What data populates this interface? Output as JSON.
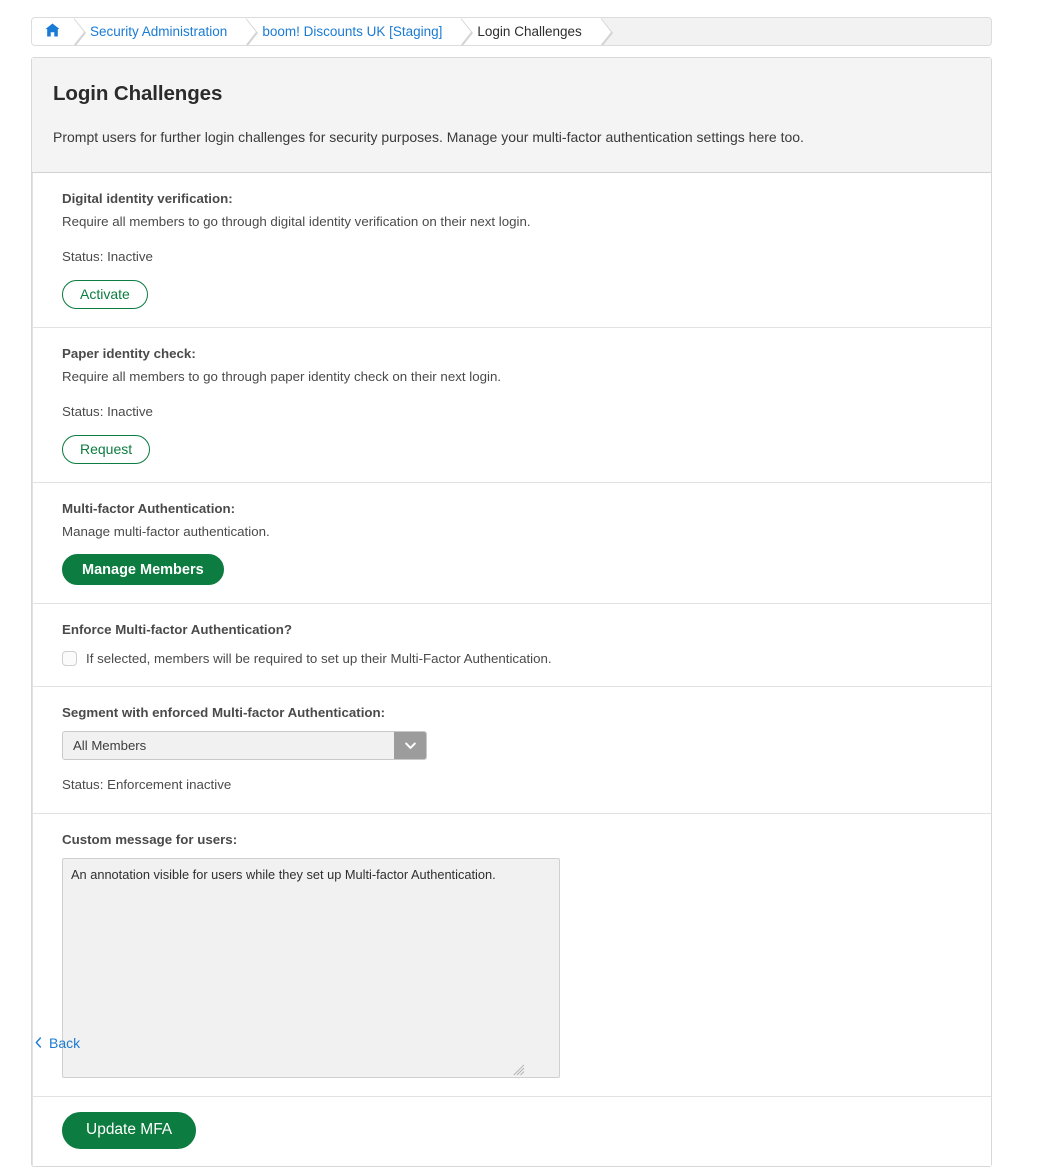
{
  "breadcrumb": {
    "home_icon": "home-icon",
    "items": [
      {
        "label": "Security Administration",
        "active": false
      },
      {
        "label": "boom! Discounts UK [Staging]",
        "active": false
      },
      {
        "label": "Login Challenges",
        "active": true
      }
    ]
  },
  "page": {
    "title": "Login Challenges",
    "subtitle": "Prompt users for further login challenges for security purposes. Manage your multi-factor authentication settings here too."
  },
  "colors": {
    "brand_green": "#0c7c40",
    "link_blue": "#1a7bd4",
    "header_bg": "#f4f4f4",
    "field_bg": "#f1f1f1",
    "select_arrow_bg": "#9c9c9c"
  },
  "sections": {
    "digital_identity": {
      "label": "Digital identity verification:",
      "description": "Require all members to go through digital identity verification on their next login.",
      "status": "Status: Inactive",
      "button": "Activate"
    },
    "paper_identity": {
      "label": "Paper identity check:",
      "description": "Require all members to go through paper identity check on their next login.",
      "status": "Status: Inactive",
      "button": "Request"
    },
    "mfa": {
      "label": "Multi-factor Authentication:",
      "description": "Manage multi-factor authentication.",
      "button": "Manage Members"
    },
    "enforce": {
      "label": "Enforce Multi-factor Authentication?",
      "checkbox_text": "If selected, members will be required to set up their Multi-Factor Authentication.",
      "checked": false
    },
    "segment": {
      "label": "Segment with enforced Multi-factor Authentication:",
      "selected_value": "All Members",
      "options": [
        "All Members"
      ],
      "status": "Status: Enforcement inactive",
      "arrow_icon": "chevron-down-icon"
    },
    "custom_message": {
      "label": "Custom message for users:",
      "value": "An annotation visible for users while they set up Multi-factor Authentication.",
      "placeholder": ""
    },
    "footer": {
      "button": "Update MFA"
    }
  },
  "back": {
    "label": "Back",
    "icon": "chevron-left-icon"
  }
}
